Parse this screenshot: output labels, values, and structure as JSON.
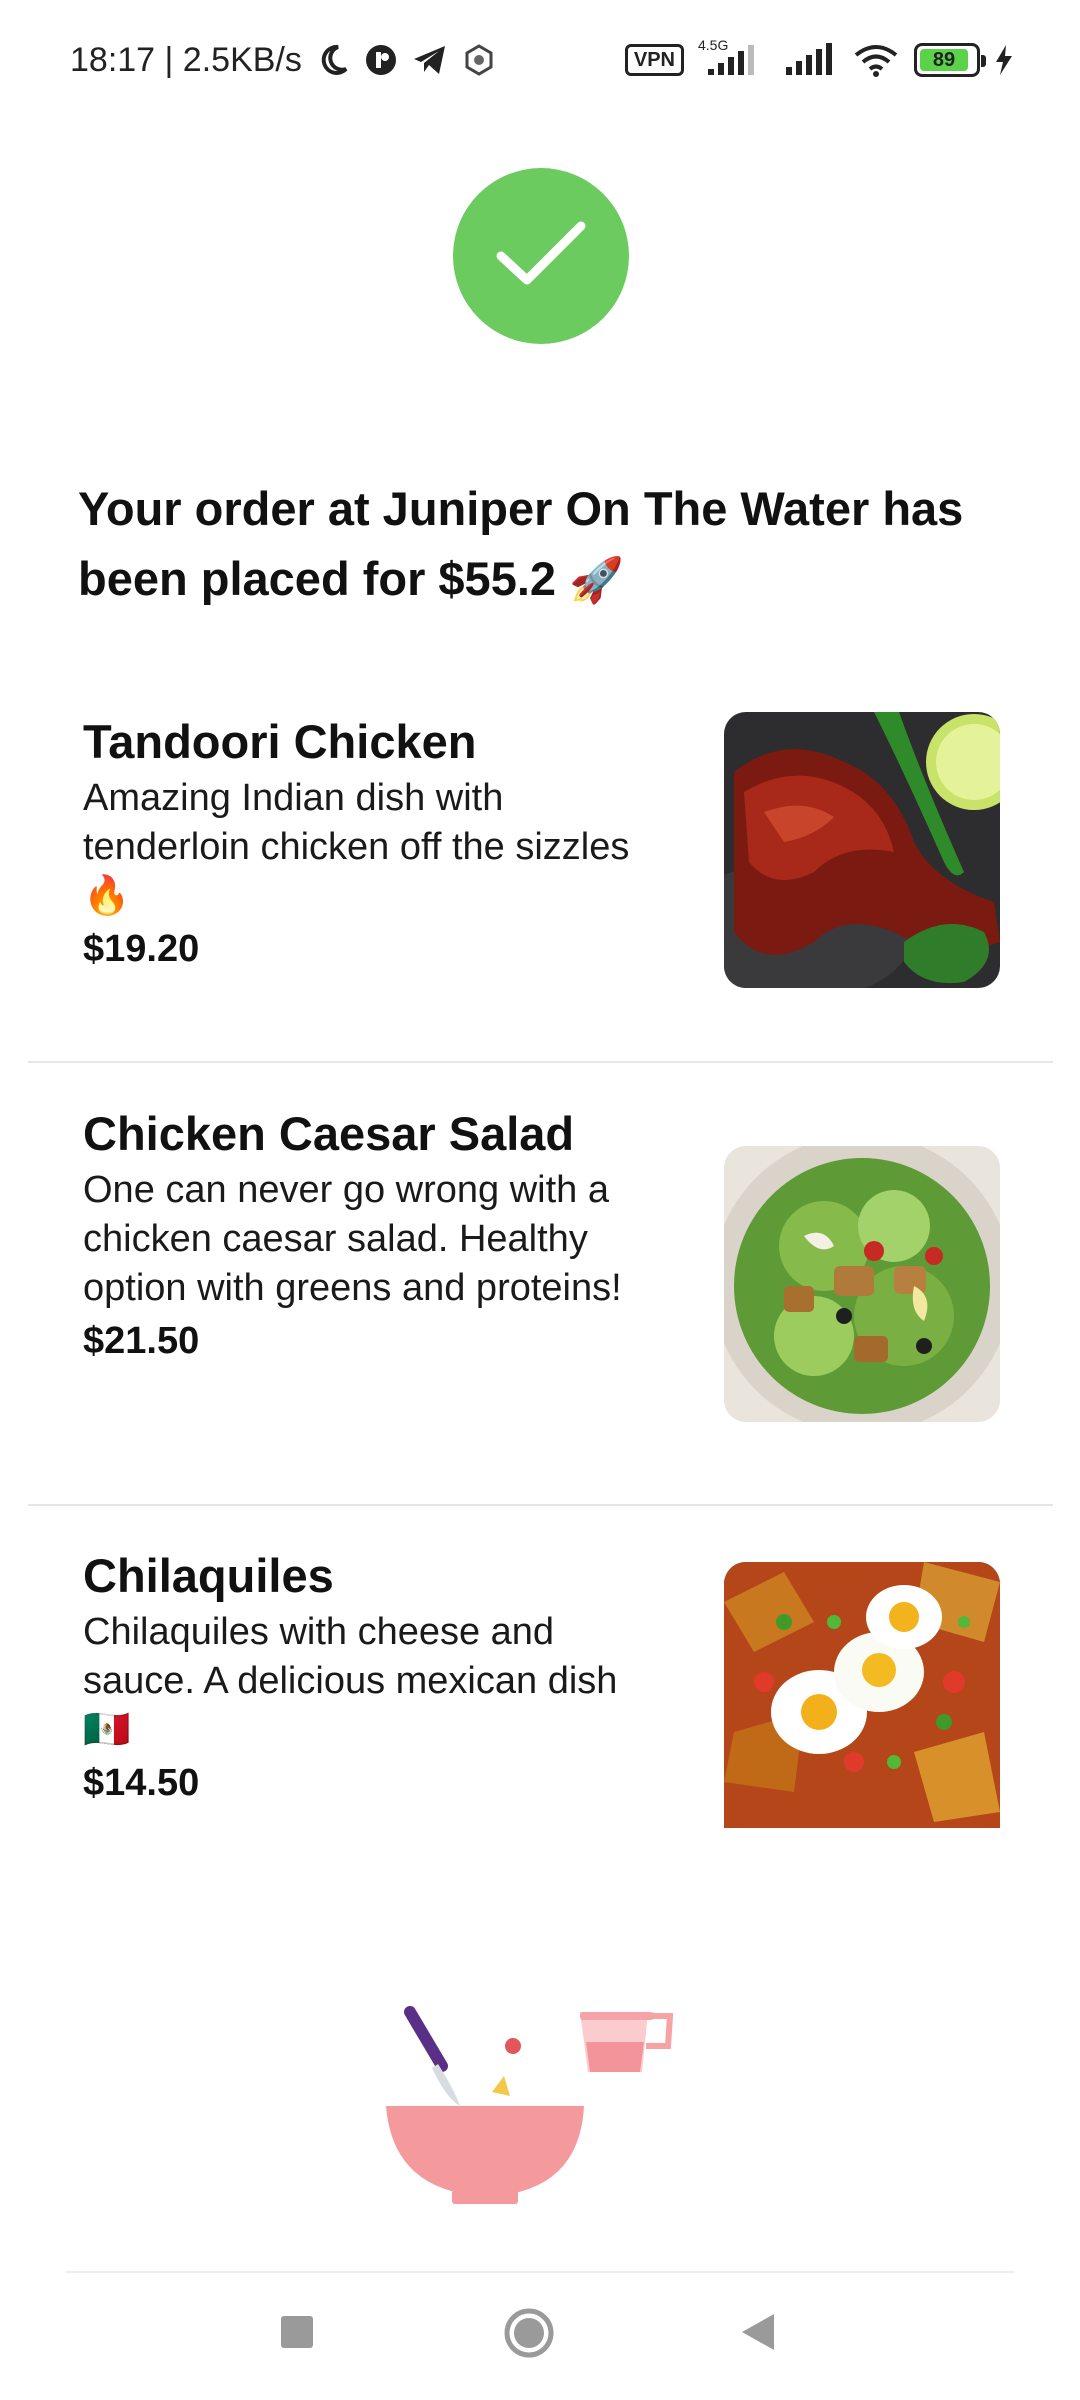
{
  "status_bar": {
    "time_speed": "18:17 | 2.5KB/s",
    "vpn_label": "VPN",
    "network_label": "4.5G",
    "battery_level": "89",
    "icons": [
      "moon-icon",
      "app-icon",
      "telegram-icon",
      "settings-icon",
      "vpn-icon",
      "signal-icon",
      "signal-icon",
      "wifi-icon",
      "battery-icon",
      "charging-icon"
    ]
  },
  "confirmation": {
    "icon": "check-icon",
    "accent_color": "#6ccb5f",
    "headline": "Your order at Juniper On The Water has been placed for $55.2",
    "headline_emoji": "🚀"
  },
  "items": [
    {
      "name": "Tandoori Chicken",
      "description": "Amazing Indian dish with tenderloin chicken off the sizzles 🔥",
      "price": "$19.20"
    },
    {
      "name": "Chicken Caesar Salad",
      "description": "One can never go wrong with a chicken caesar salad. Healthy option with greens and proteins!",
      "price": "$21.50"
    },
    {
      "name": "Chilaquiles",
      "description": "Chilaquiles with cheese and sauce. A delicious mexican dish 🇲🇽",
      "price": "$14.50"
    }
  ],
  "nav_bar": {
    "buttons": [
      "recents-button",
      "home-button",
      "back-button"
    ]
  }
}
